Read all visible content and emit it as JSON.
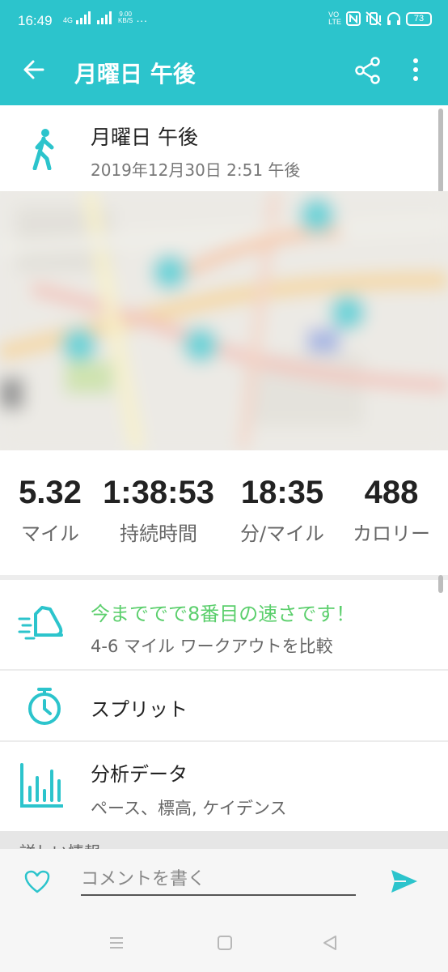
{
  "status_bar": {
    "time": "16:49",
    "network": "4G",
    "speed_value": "9.00",
    "speed_unit": "KB/S",
    "overflow": "···",
    "volte_top": "VO",
    "volte_bottom": "LTE",
    "battery": "73"
  },
  "app_bar": {
    "title": "月曜日 午後",
    "background": "#2cc4cc"
  },
  "activity": {
    "name": "月曜日 午後",
    "date": "2019年12月30日 2:51 午後",
    "icon": "walking-person-icon"
  },
  "stats": [
    {
      "value": "5.32",
      "label": "マイル"
    },
    {
      "value": "1:38:53",
      "label": "持続時間"
    },
    {
      "value": "18:35",
      "label": "分/マイル"
    },
    {
      "value": "488",
      "label": "カロリー"
    }
  ],
  "achievement": {
    "title": "今まででで8番目の速さです！",
    "subtitle": "4-6 マイル ワークアウトを比較",
    "icon": "running-shoe-icon",
    "title_color": "#5ccf6d"
  },
  "splits": {
    "title": "スプリット",
    "icon": "stopwatch-icon"
  },
  "analysis": {
    "title": "分析データ",
    "subtitle": "ペース、標高, ケイデンス",
    "icon": "bar-chart-icon"
  },
  "more_info": {
    "label": "詳しい情報"
  },
  "comment": {
    "placeholder": "コメントを書く",
    "value": ""
  },
  "colors": {
    "accent": "#2cc4cc",
    "highlight_green": "#5ccf6d"
  }
}
